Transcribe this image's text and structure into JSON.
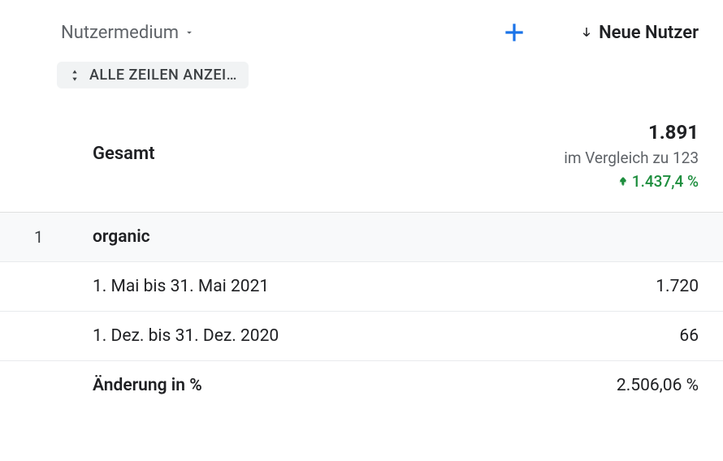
{
  "header": {
    "dimension_label": "Nutzermedium",
    "metric_label": "Neue Nutzer"
  },
  "expand": {
    "label": "ALLE ZEILEN ANZEI…"
  },
  "total": {
    "label": "Gesamt",
    "value": "1.891",
    "compare_text": "im Vergleich zu 123",
    "change_percent": "1.437,4 %"
  },
  "rows": [
    {
      "index": "1",
      "name": "organic",
      "period1_label": "1. Mai bis 31. Mai 2021",
      "period1_value": "1.720",
      "period2_label": "1. Dez. bis 31. Dez. 2020",
      "period2_value": "66",
      "change_label": "Änderung in %",
      "change_value": "2.506,06 %"
    }
  ]
}
